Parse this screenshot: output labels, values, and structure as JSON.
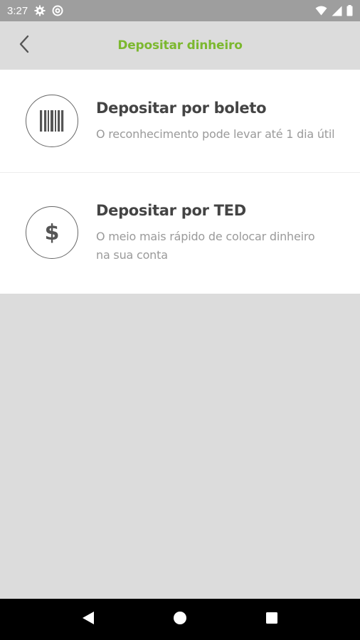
{
  "status_bar": {
    "time": "3:27",
    "icons": [
      "settings-gear-icon",
      "at-sign-icon",
      "wifi-icon",
      "signal-icon",
      "battery-icon"
    ]
  },
  "app_bar": {
    "back_icon": "chevron-left-icon",
    "title": "Depositar dinheiro",
    "title_color": "#7cb82f"
  },
  "options": [
    {
      "icon": "barcode-icon",
      "title": "Depositar por boleto",
      "description": "O reconhecimento pode levar até 1 dia útil"
    },
    {
      "icon": "dollar-icon",
      "title": "Depositar por TED",
      "description": "O meio mais rápido de colocar dinheiro na sua conta"
    }
  ],
  "nav_bar": {
    "buttons": [
      "back-triangle-icon",
      "home-circle-icon",
      "recents-square-icon"
    ]
  }
}
